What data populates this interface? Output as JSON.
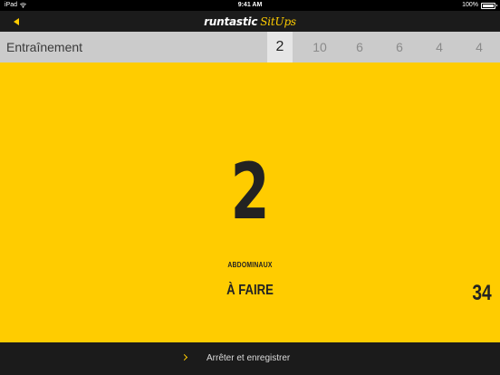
{
  "status_bar": {
    "device": "iPad",
    "time": "9:41 AM",
    "battery": "100%",
    "battery_level": 1.0
  },
  "nav": {
    "logo_main": "runtastic",
    "logo_sub": "SitUps"
  },
  "workout": {
    "label": "Entraînement",
    "sets": [
      "2",
      "10",
      "6",
      "6",
      "4",
      "4"
    ],
    "active_index": 0
  },
  "main": {
    "count": "2",
    "exercise": "ABDOMINAUX",
    "todo_label": "À FAIRE",
    "remaining": "34"
  },
  "bottom": {
    "stop_label": "Arrêter et enregistrer"
  },
  "colors": {
    "accent": "#ffcc00",
    "bar": "#1b1b1b",
    "row": "#cbcbcb",
    "active_cell": "#e6e6e6"
  }
}
